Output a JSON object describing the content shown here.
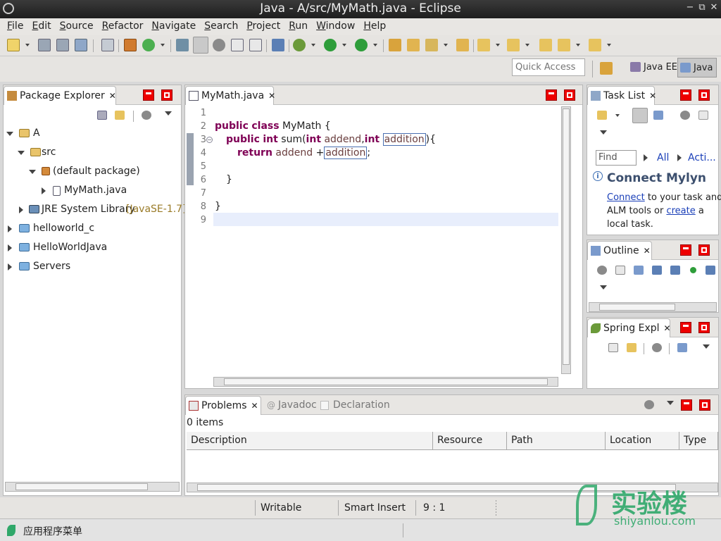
{
  "window": {
    "title": "Java - A/src/MyMath.java - Eclipse",
    "controls": [
      "−",
      "⧉",
      "✕"
    ]
  },
  "menu": [
    "File",
    "Edit",
    "Source",
    "Refactor",
    "Navigate",
    "Search",
    "Project",
    "Run",
    "Window",
    "Help"
  ],
  "quick_access": {
    "placeholder": "Quick Access"
  },
  "perspectives": [
    {
      "label": "Java EE"
    },
    {
      "label": "Java"
    }
  ],
  "package_explorer": {
    "title": "Package Explorer",
    "tree": [
      {
        "label": "A"
      },
      {
        "label": "src"
      },
      {
        "label": "(default package)"
      },
      {
        "label": "MyMath.java"
      },
      {
        "label": "JRE System Library",
        "suffix": "[JavaSE-1.7]"
      },
      {
        "label": "helloworld_c"
      },
      {
        "label": "HelloWorldJava"
      },
      {
        "label": "Servers"
      }
    ]
  },
  "editor": {
    "tab": "MyMath.java",
    "line_numbers": [
      "1",
      "2",
      "3",
      "4",
      "5",
      "6",
      "7",
      "8",
      "9"
    ],
    "tokens": {
      "public": "public",
      "class": "class",
      "classname": "MyMath",
      "brace_open": " {",
      "int": "int",
      "sum_open": " sum(",
      "addend": "addend",
      "comma": ",",
      "addition": "addition",
      "close_paren": ")",
      "brace2": "{",
      "return": "return",
      "plus": " +",
      "semi": ";",
      "close_inner": "}",
      "close_outer": "}"
    }
  },
  "task_list": {
    "title": "Task List",
    "find_placeholder": "Find",
    "all": "All",
    "acti": "Acti..."
  },
  "mylyn": {
    "title": "Connect Mylyn",
    "connect": "Connect",
    "text1": " to your task and",
    "text2": "ALM tools or ",
    "create": "create",
    "text3": " a",
    "text4": "local task."
  },
  "outline": {
    "title": "Outline"
  },
  "spring": {
    "title": "Spring Expl"
  },
  "problems": {
    "tabs": [
      "Problems",
      "Javadoc",
      "Declaration"
    ],
    "count": "0 items",
    "columns": [
      "Description",
      "Resource",
      "Path",
      "Location",
      "Type"
    ]
  },
  "status": {
    "writable": "Writable",
    "insert_mode": "Smart Insert",
    "position": "9 : 1"
  },
  "taskbar": {
    "menu": "应用程序菜单"
  },
  "watermark": {
    "brand": "实验楼",
    "url": "shiyanlou.com"
  },
  "colors": {
    "keyword": "#7f0055",
    "variable": "#6a3e3e",
    "minmax": "#e00000",
    "link": "#1a3fb8",
    "watermark": "#2fa86a"
  }
}
